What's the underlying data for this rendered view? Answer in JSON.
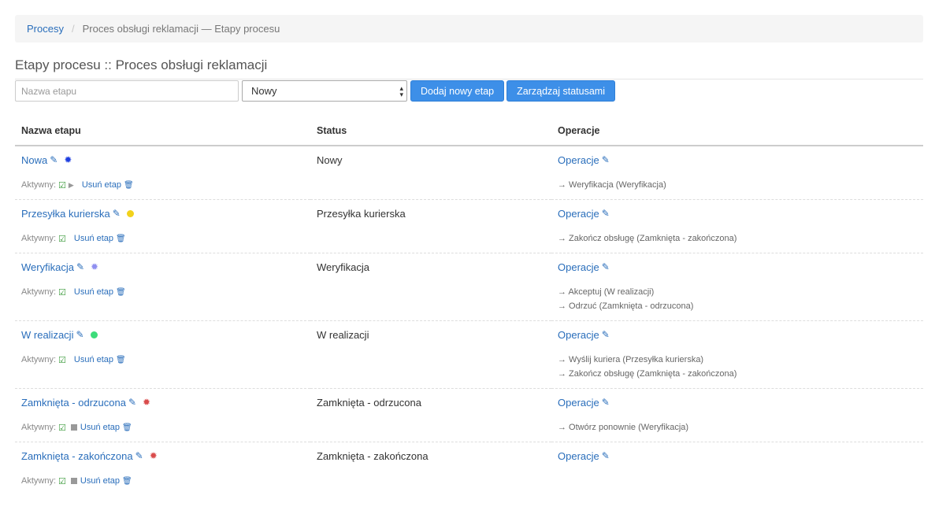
{
  "breadcrumb": {
    "root": "Procesy",
    "separator": "/",
    "current": "Proces obsługi reklamacji — Etapy procesu"
  },
  "title": "Etapy procesu :: Proces obsługi reklamacji",
  "form": {
    "name_placeholder": "Nazwa etapu",
    "status_selected": "Nowy",
    "add_button": "Dodaj nowy etap",
    "manage_button": "Zarządzaj statusami"
  },
  "table": {
    "headers": [
      "Nazwa etapu",
      "Status",
      "Operacje"
    ],
    "active_label": "Aktywny:",
    "delete_label": "Usuń etap",
    "operations_label": "Operacje",
    "rows": [
      {
        "name": "Nowa",
        "status": "Nowy",
        "color": "#1f3fe0",
        "marker": "burst",
        "flag": "play",
        "transitions": [
          "→ Weryfikacja (Weryfikacja)"
        ]
      },
      {
        "name": "Przesyłka kurierska",
        "status": "Przesyłka kurierska",
        "color": "#f2d21b",
        "marker": "dot",
        "flag": "none",
        "transitions": [
          "→ Zakończ obsługę (Zamknięta - zakończona)"
        ]
      },
      {
        "name": "Weryfikacja",
        "status": "Weryfikacja",
        "color": "#8f8ff0",
        "marker": "burst",
        "flag": "none",
        "transitions": [
          "→ Akceptuj (W realizacji)",
          "→ Odrzuć (Zamknięta - odrzucona)"
        ]
      },
      {
        "name": "W realizacji",
        "status": "W realizacji",
        "color": "#3ddc7a",
        "marker": "dot",
        "flag": "none",
        "transitions": [
          "→ Wyślij kuriera (Przesyłka kurierska)",
          "→ Zakończ obsługę (Zamknięta - zakończona)"
        ]
      },
      {
        "name": "Zamknięta - odrzucona",
        "status": "Zamknięta - odrzucona",
        "color": "#d94b4b",
        "marker": "burst",
        "flag": "stop",
        "transitions": [
          "→ Otwórz ponownie (Weryfikacja)"
        ]
      },
      {
        "name": "Zamknięta - zakończona",
        "status": "Zamknięta - zakończona",
        "color": "#d94b4b",
        "marker": "burst",
        "flag": "stop",
        "transitions": []
      }
    ]
  }
}
